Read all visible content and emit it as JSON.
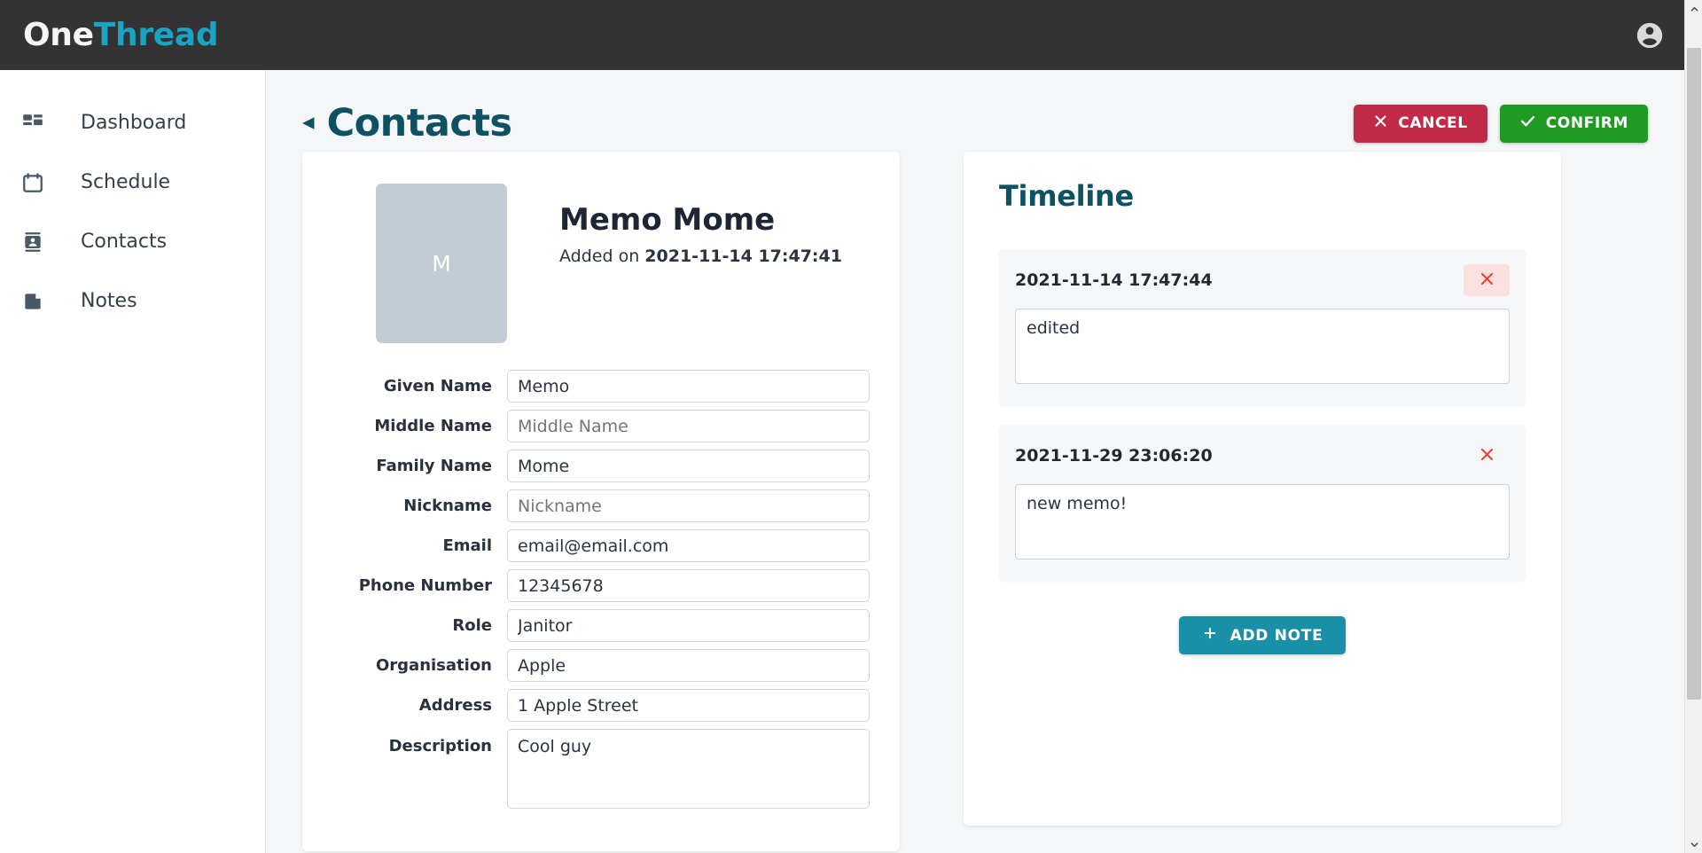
{
  "app": {
    "logo_primary": "One",
    "logo_secondary": "Thread",
    "account_icon": "account-circle-icon",
    "accent_teal": "#19a3c4",
    "header_bg": "#333333"
  },
  "sidebar": {
    "items": [
      {
        "label": "Dashboard",
        "icon": "dashboard-grid-icon"
      },
      {
        "label": "Schedule",
        "icon": "calendar-icon"
      },
      {
        "label": "Contacts",
        "icon": "contact-card-icon"
      },
      {
        "label": "Notes",
        "icon": "note-page-icon"
      }
    ]
  },
  "header": {
    "back_chevron": "◂",
    "title": "Contacts",
    "cancel_label": "CANCEL",
    "cancel_icon": "close-x-icon",
    "cancel_color": "#c32a48",
    "confirm_label": "CONFIRM",
    "confirm_icon": "check-icon",
    "confirm_color": "#1f9b23"
  },
  "contact": {
    "avatar_initial": "M",
    "avatar_color": "#c3ccd4",
    "full_name": "Memo Mome",
    "added_prefix": "Added on",
    "added_on": "2021-11-14 17:47:41",
    "fields": [
      {
        "label": "Given Name",
        "value": "Memo",
        "type": "text",
        "placeholder": "Given Name"
      },
      {
        "label": "Middle Name",
        "value": "",
        "type": "text",
        "placeholder": "Middle Name"
      },
      {
        "label": "Family Name",
        "value": "Mome",
        "type": "text",
        "placeholder": "Family Name"
      },
      {
        "label": "Nickname",
        "value": "",
        "type": "text",
        "placeholder": "Nickname"
      },
      {
        "label": "Email",
        "value": "email@email.com",
        "type": "text",
        "placeholder": "Email"
      },
      {
        "label": "Phone Number",
        "value": "12345678",
        "type": "text",
        "placeholder": "Phone Number"
      },
      {
        "label": "Role",
        "value": "Janitor",
        "type": "text",
        "placeholder": "Role"
      },
      {
        "label": "Organisation",
        "value": "Apple",
        "type": "text",
        "placeholder": "Organisation"
      },
      {
        "label": "Address",
        "value": "1 Apple Street",
        "type": "text",
        "placeholder": "Address"
      },
      {
        "label": "Description",
        "value": "Cool guy",
        "type": "textarea",
        "placeholder": "Description"
      }
    ]
  },
  "timeline": {
    "title": "Timeline",
    "title_color": "#0d5162",
    "delete_icon": "close-x-icon",
    "delete_color": "#ee3b30",
    "notes": [
      {
        "date": "2021-11-14 17:47:44",
        "body": "edited",
        "delete_hovered": true
      },
      {
        "date": "2021-11-29 23:06:20",
        "body": "new memo!",
        "delete_hovered": false
      }
    ],
    "add_note_label": "ADD NOTE",
    "add_note_icon": "plus-icon",
    "add_note_color": "#1a8fa8"
  },
  "scrollbar": {
    "up_arrow": "scroll-up-arrow",
    "down_arrow": "scroll-down-arrow"
  }
}
